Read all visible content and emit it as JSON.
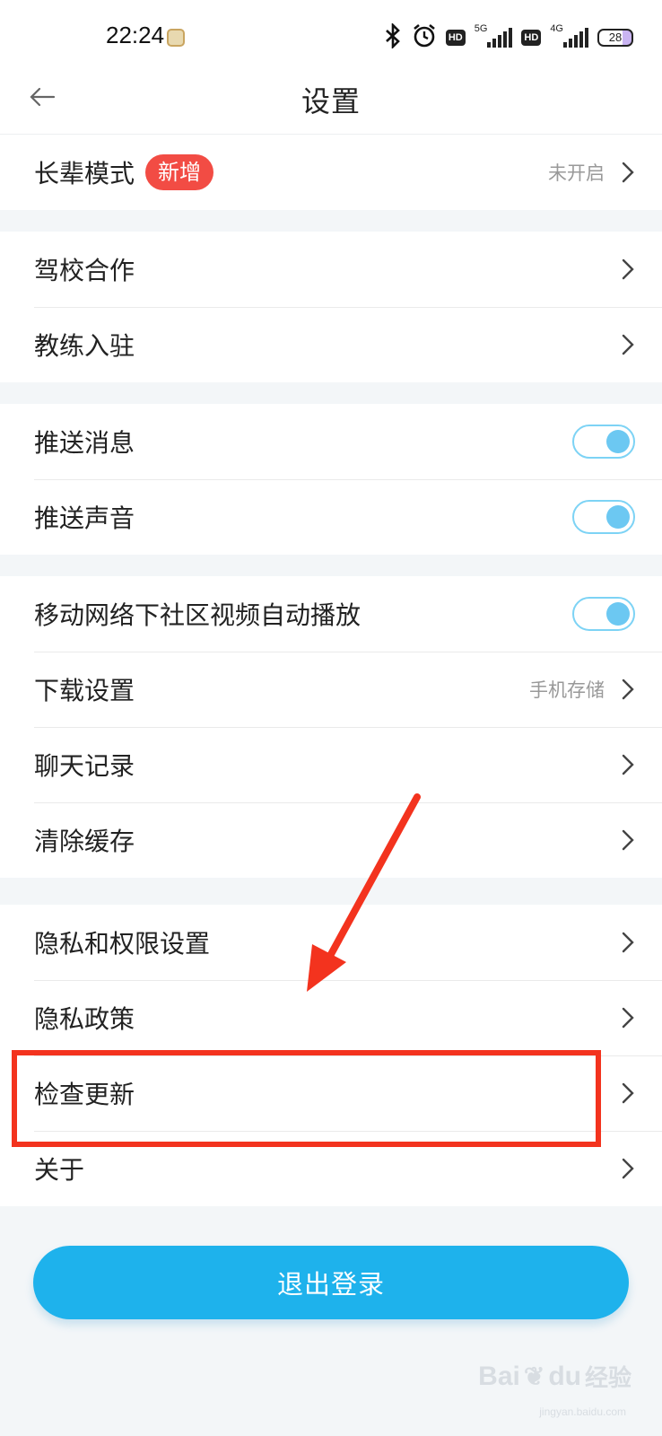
{
  "status_bar": {
    "time": "22:24",
    "network_5g": "5G",
    "network_4g": "4G",
    "hd": "HD",
    "battery": "28",
    "icons": [
      "bluetooth-icon",
      "alarm-icon",
      "signal-icon",
      "battery-icon"
    ]
  },
  "header": {
    "title": "设置",
    "back_icon": "back-arrow-icon"
  },
  "groups": [
    {
      "items": [
        {
          "label": "长辈模式",
          "badge": "新增",
          "value": "未开启",
          "control": "chevron"
        }
      ]
    },
    {
      "items": [
        {
          "label": "驾校合作",
          "control": "chevron"
        },
        {
          "label": "教练入驻",
          "control": "chevron"
        }
      ]
    },
    {
      "items": [
        {
          "label": "推送消息",
          "control": "toggle",
          "on": true
        },
        {
          "label": "推送声音",
          "control": "toggle",
          "on": true
        }
      ]
    },
    {
      "items": [
        {
          "label": "移动网络下社区视频自动播放",
          "control": "toggle",
          "on": true
        },
        {
          "label": "下载设置",
          "value": "手机存储",
          "control": "chevron"
        },
        {
          "label": "聊天记录",
          "control": "chevron"
        },
        {
          "label": "清除缓存",
          "control": "chevron"
        }
      ]
    },
    {
      "items": [
        {
          "label": "隐私和权限设置",
          "control": "chevron"
        },
        {
          "label": "隐私政策",
          "control": "chevron"
        },
        {
          "label": "检查更新",
          "control": "chevron"
        },
        {
          "label": "关于",
          "control": "chevron"
        }
      ]
    }
  ],
  "logout_label": "退出登录",
  "watermark": {
    "brand": "Bai",
    "brand_du": "du",
    "brand_cn": "经验",
    "url": "jingyan.baidu.com"
  },
  "colors": {
    "accent": "#1eb2ec",
    "badge": "#f24c44",
    "annotation": "#f3331e",
    "toggle": "#6cc8f2"
  }
}
